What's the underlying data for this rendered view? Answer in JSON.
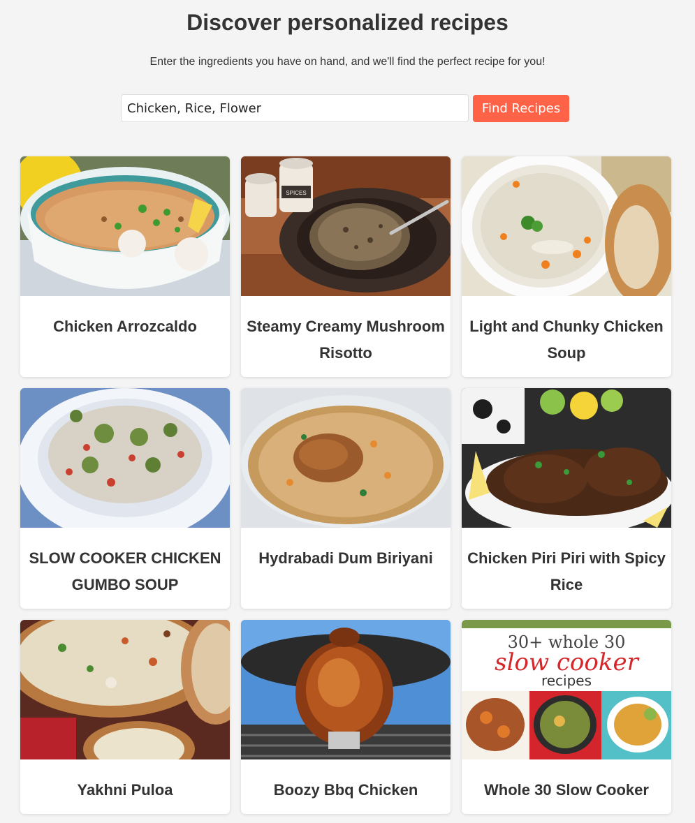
{
  "header": {
    "title": "Discover personalized recipes",
    "subtitle": "Enter the ingredients you have on hand, and we'll find the perfect recipe for you!"
  },
  "search": {
    "value": "Chicken, Rice, Flower",
    "button_label": "Find Recipes"
  },
  "recipes": [
    {
      "title": "Chicken Arrozcaldo"
    },
    {
      "title": "Steamy Creamy Mushroom Risotto"
    },
    {
      "title": "Light and Chunky Chicken Soup"
    },
    {
      "title": "SLOW COOKER CHICKEN GUMBO SOUP"
    },
    {
      "title": "Hydrabadi Dum Biriyani"
    },
    {
      "title": "Chicken Piri Piri with Spicy Rice"
    },
    {
      "title": "Yakhni Puloa"
    },
    {
      "title": "Boozy Bbq Chicken"
    },
    {
      "title": "Whole 30 Slow Cooker"
    }
  ],
  "photo_text": {
    "spices_jar": "SPICES",
    "promo_line1": "30+ whole 30",
    "promo_line2": "slow cooker",
    "promo_line3": "recipes"
  },
  "colors": {
    "accent": "#ff6347",
    "background": "#f4f4f4",
    "card": "#ffffff",
    "text": "#333333"
  }
}
